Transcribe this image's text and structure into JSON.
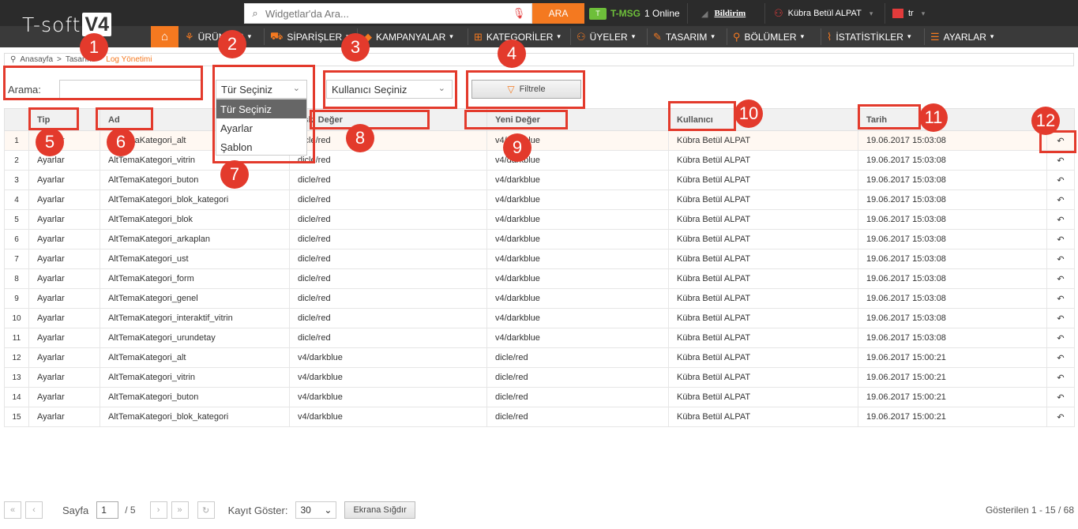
{
  "header": {
    "logo_text": "T-soft",
    "logo_version": "V4",
    "search_placeholder": "Widgetlar'da Ara...",
    "search_button": "ARA",
    "tmsg_icon": "T",
    "tmsg_brand": "T-MSG",
    "tmsg_status": "1 Online",
    "bildirim": "Bildirim",
    "user_name": "Kübra Betül ALPAT",
    "lang": "tr"
  },
  "nav": {
    "items": [
      {
        "label": "ÜRÜNLER",
        "icon": "shirt-icon"
      },
      {
        "label": "SİPARİŞLER",
        "icon": "cart-icon"
      },
      {
        "label": "KAMPANYALAR",
        "icon": "tag-icon"
      },
      {
        "label": "KATEGORİLER",
        "icon": "category-icon"
      },
      {
        "label": "ÜYELER",
        "icon": "users-icon"
      },
      {
        "label": "TASARIM",
        "icon": "brush-icon"
      },
      {
        "label": "BÖLÜMLER",
        "icon": "sections-icon"
      },
      {
        "label": "İSTATİSTİKLER",
        "icon": "stats-icon"
      },
      {
        "label": "AYARLAR",
        "icon": "settings-icon"
      }
    ]
  },
  "breadcrumb": {
    "home": "Anasayfa",
    "sep1": ">",
    "section": "Tasarım",
    "sep2": ">",
    "current": "Log Yönetimi"
  },
  "filters": {
    "search_label": "Arama:",
    "search_value": "",
    "type_select_value": "Tür Seçiniz",
    "type_options": [
      "Tür Seçiniz",
      "Ayarlar",
      "Şablon"
    ],
    "user_select_value": "Kullanıcı Seçiniz",
    "filter_button": "Filtrele"
  },
  "table": {
    "columns": [
      "",
      "Tip",
      "Ad",
      "Eski Değer",
      "Yeni Değer",
      "Kullanıcı",
      "Tarih",
      ""
    ],
    "rows": [
      [
        "1",
        "Ayarlar",
        "AltTemaKategori_alt",
        "dicle/red",
        "v4/darkblue",
        "Kübra Betül ALPAT",
        "19.06.2017 15:03:08"
      ],
      [
        "2",
        "Ayarlar",
        "AltTemaKategori_vitrin",
        "dicle/red",
        "v4/darkblue",
        "Kübra Betül ALPAT",
        "19.06.2017 15:03:08"
      ],
      [
        "3",
        "Ayarlar",
        "AltTemaKategori_buton",
        "dicle/red",
        "v4/darkblue",
        "Kübra Betül ALPAT",
        "19.06.2017 15:03:08"
      ],
      [
        "4",
        "Ayarlar",
        "AltTemaKategori_blok_kategori",
        "dicle/red",
        "v4/darkblue",
        "Kübra Betül ALPAT",
        "19.06.2017 15:03:08"
      ],
      [
        "5",
        "Ayarlar",
        "AltTemaKategori_blok",
        "dicle/red",
        "v4/darkblue",
        "Kübra Betül ALPAT",
        "19.06.2017 15:03:08"
      ],
      [
        "6",
        "Ayarlar",
        "AltTemaKategori_arkaplan",
        "dicle/red",
        "v4/darkblue",
        "Kübra Betül ALPAT",
        "19.06.2017 15:03:08"
      ],
      [
        "7",
        "Ayarlar",
        "AltTemaKategori_ust",
        "dicle/red",
        "v4/darkblue",
        "Kübra Betül ALPAT",
        "19.06.2017 15:03:08"
      ],
      [
        "8",
        "Ayarlar",
        "AltTemaKategori_form",
        "dicle/red",
        "v4/darkblue",
        "Kübra Betül ALPAT",
        "19.06.2017 15:03:08"
      ],
      [
        "9",
        "Ayarlar",
        "AltTemaKategori_genel",
        "dicle/red",
        "v4/darkblue",
        "Kübra Betül ALPAT",
        "19.06.2017 15:03:08"
      ],
      [
        "10",
        "Ayarlar",
        "AltTemaKategori_interaktif_vitrin",
        "dicle/red",
        "v4/darkblue",
        "Kübra Betül ALPAT",
        "19.06.2017 15:03:08"
      ],
      [
        "11",
        "Ayarlar",
        "AltTemaKategori_urundetay",
        "dicle/red",
        "v4/darkblue",
        "Kübra Betül ALPAT",
        "19.06.2017 15:03:08"
      ],
      [
        "12",
        "Ayarlar",
        "AltTemaKategori_alt",
        "v4/darkblue",
        "dicle/red",
        "Kübra Betül ALPAT",
        "19.06.2017 15:00:21"
      ],
      [
        "13",
        "Ayarlar",
        "AltTemaKategori_vitrin",
        "v4/darkblue",
        "dicle/red",
        "Kübra Betül ALPAT",
        "19.06.2017 15:00:21"
      ],
      [
        "14",
        "Ayarlar",
        "AltTemaKategori_buton",
        "v4/darkblue",
        "dicle/red",
        "Kübra Betül ALPAT",
        "19.06.2017 15:00:21"
      ],
      [
        "15",
        "Ayarlar",
        "AltTemaKategori_blok_kategori",
        "v4/darkblue",
        "dicle/red",
        "Kübra Betül ALPAT",
        "19.06.2017 15:00:21"
      ]
    ]
  },
  "pager": {
    "page_label": "Sayfa",
    "page_value": "1",
    "page_total": "/ 5",
    "records_label": "Kayıt Göster:",
    "records_value": "30",
    "fit_button": "Ekrana Sığdır",
    "info": "Gösterilen 1 - 15 / 68"
  },
  "annotations": [
    "1",
    "2",
    "3",
    "4",
    "5",
    "6",
    "7",
    "8",
    "9",
    "10",
    "11",
    "12"
  ],
  "colors": {
    "accent": "#f47920",
    "annotation": "#e33a2c",
    "header": "#2b2b2b"
  }
}
